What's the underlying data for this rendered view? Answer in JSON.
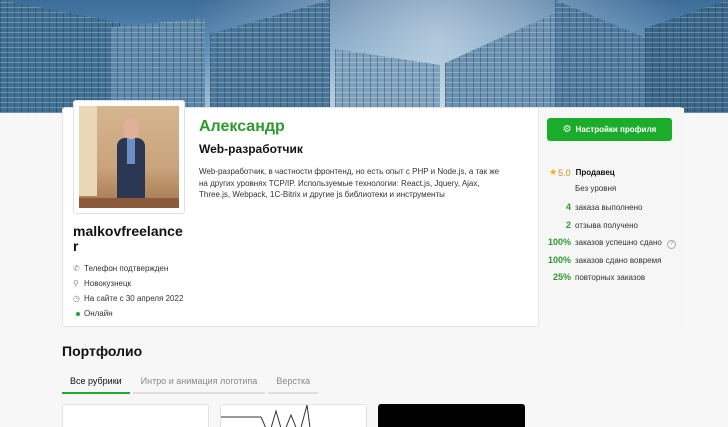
{
  "profile": {
    "name": "Александр",
    "role": "Web-разработчик",
    "description": "Web-разработчик, в частности фронтенд, но есть опыт с PHP и Node.js, а так же на других уровнях TCP/IP. Используемые технологии: React.js, Jquery, Ajax, Three.js, Webpack, 1C-Bitrix и другие js библиотеки и инструменты",
    "username": "malkovfreelancer",
    "phone": "Телефон подтвержден",
    "city": "Новокузнецк",
    "since": "На сайте с 30 апреля 2022",
    "status": "Онлайн"
  },
  "actions": {
    "settings": "Настройки профиля"
  },
  "rating": {
    "score": "5.0",
    "label": "Продавец",
    "level": "Без уровня"
  },
  "stats": [
    {
      "num": "4",
      "text": "заказа выполнено"
    },
    {
      "num": "2",
      "text": "отзыва получено"
    },
    {
      "num": "100%",
      "text": "заказов успешно сдано"
    },
    {
      "num": "100%",
      "text": "заказов сдано вовремя"
    },
    {
      "num": "25%",
      "text": "повторных заказов"
    }
  ],
  "portfolio": {
    "title": "Портфолио",
    "tabs": [
      "Все рубрики",
      "Интро и анимация логотипа",
      "Верстка"
    ]
  },
  "colors": {
    "accent": "#1cac2c",
    "accent_text": "#2c9a2d",
    "star": "#f0b100"
  }
}
